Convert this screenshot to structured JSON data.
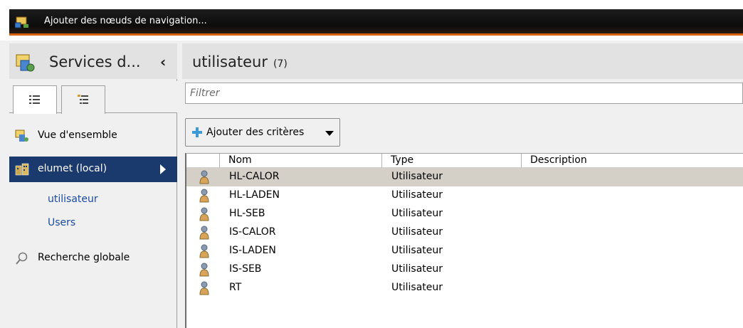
{
  "window": {
    "title": "Ajouter des nœuds de navigation..."
  },
  "left_panel": {
    "title": "Services d...",
    "nav": {
      "overview": "Vue d'ensemble",
      "domain": "elumet (local)",
      "sub_items": [
        "utilisateur",
        "Users"
      ],
      "search": "Recherche globale"
    }
  },
  "main": {
    "title": "utilisateur",
    "count": "(7)",
    "filter_placeholder": "Filtrer",
    "add_criteria": "Ajouter des critères",
    "columns": [
      "Nom",
      "Type",
      "Description"
    ],
    "rows": [
      {
        "name": "HL-CALOR",
        "type": "Utilisateur",
        "description": ""
      },
      {
        "name": "HL-LADEN",
        "type": "Utilisateur",
        "description": ""
      },
      {
        "name": "HL-SEB",
        "type": "Utilisateur",
        "description": ""
      },
      {
        "name": "IS-CALOR",
        "type": "Utilisateur",
        "description": ""
      },
      {
        "name": "IS-LADEN",
        "type": "Utilisateur",
        "description": ""
      },
      {
        "name": "IS-SEB",
        "type": "Utilisateur",
        "description": ""
      },
      {
        "name": "RT",
        "type": "Utilisateur",
        "description": ""
      }
    ]
  },
  "colors": {
    "selection": "#1a3a6e",
    "accent": "#d6620f",
    "row_highlight": "#d4d0c8"
  }
}
